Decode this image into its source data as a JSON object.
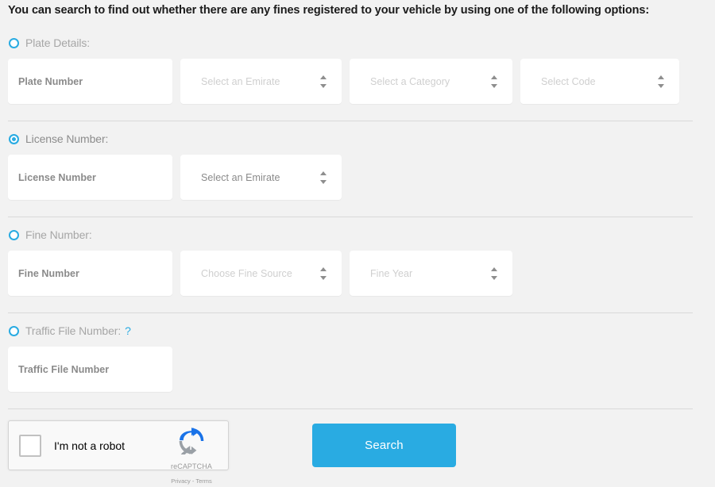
{
  "intro": {
    "text": "You can search to find out whether there are any fines registered to your vehicle by using one of the following options:"
  },
  "accent_color": "#29abe2",
  "sections": [
    {
      "id": "plate-details",
      "label": "Plate Details:",
      "selected": false,
      "fields": [
        {
          "name": "plate-number-input",
          "type": "text",
          "placeholder": "Plate Number"
        },
        {
          "name": "emirate-select",
          "type": "select",
          "placeholder": "Select an Emirate"
        },
        {
          "name": "category-select",
          "type": "select",
          "placeholder": "Select a Category"
        },
        {
          "name": "code-select",
          "type": "select",
          "placeholder": "Select Code"
        }
      ]
    },
    {
      "id": "license-number",
      "label": "License Number:",
      "selected": true,
      "fields": [
        {
          "name": "license-number-input",
          "type": "text",
          "placeholder": "License Number"
        },
        {
          "name": "license-emirate-select",
          "type": "select",
          "placeholder": "Select an Emirate"
        }
      ]
    },
    {
      "id": "fine-number",
      "label": "Fine Number:",
      "selected": false,
      "fields": [
        {
          "name": "fine-number-input",
          "type": "text",
          "placeholder": "Fine Number"
        },
        {
          "name": "fine-source-select",
          "type": "select",
          "placeholder": "Choose Fine Source"
        },
        {
          "name": "fine-year-select",
          "type": "select",
          "placeholder": "Fine Year"
        }
      ]
    },
    {
      "id": "traffic-file-number",
      "label": "Traffic File Number:",
      "help": "?",
      "selected": false,
      "fields": [
        {
          "name": "traffic-file-number-input",
          "type": "text",
          "placeholder": "Traffic File Number"
        }
      ]
    }
  ],
  "recaptcha": {
    "checkbox_label": "I'm not a robot",
    "brand": "reCAPTCHA",
    "legal": "Privacy - Terms"
  },
  "search_button": {
    "label": "Search"
  }
}
